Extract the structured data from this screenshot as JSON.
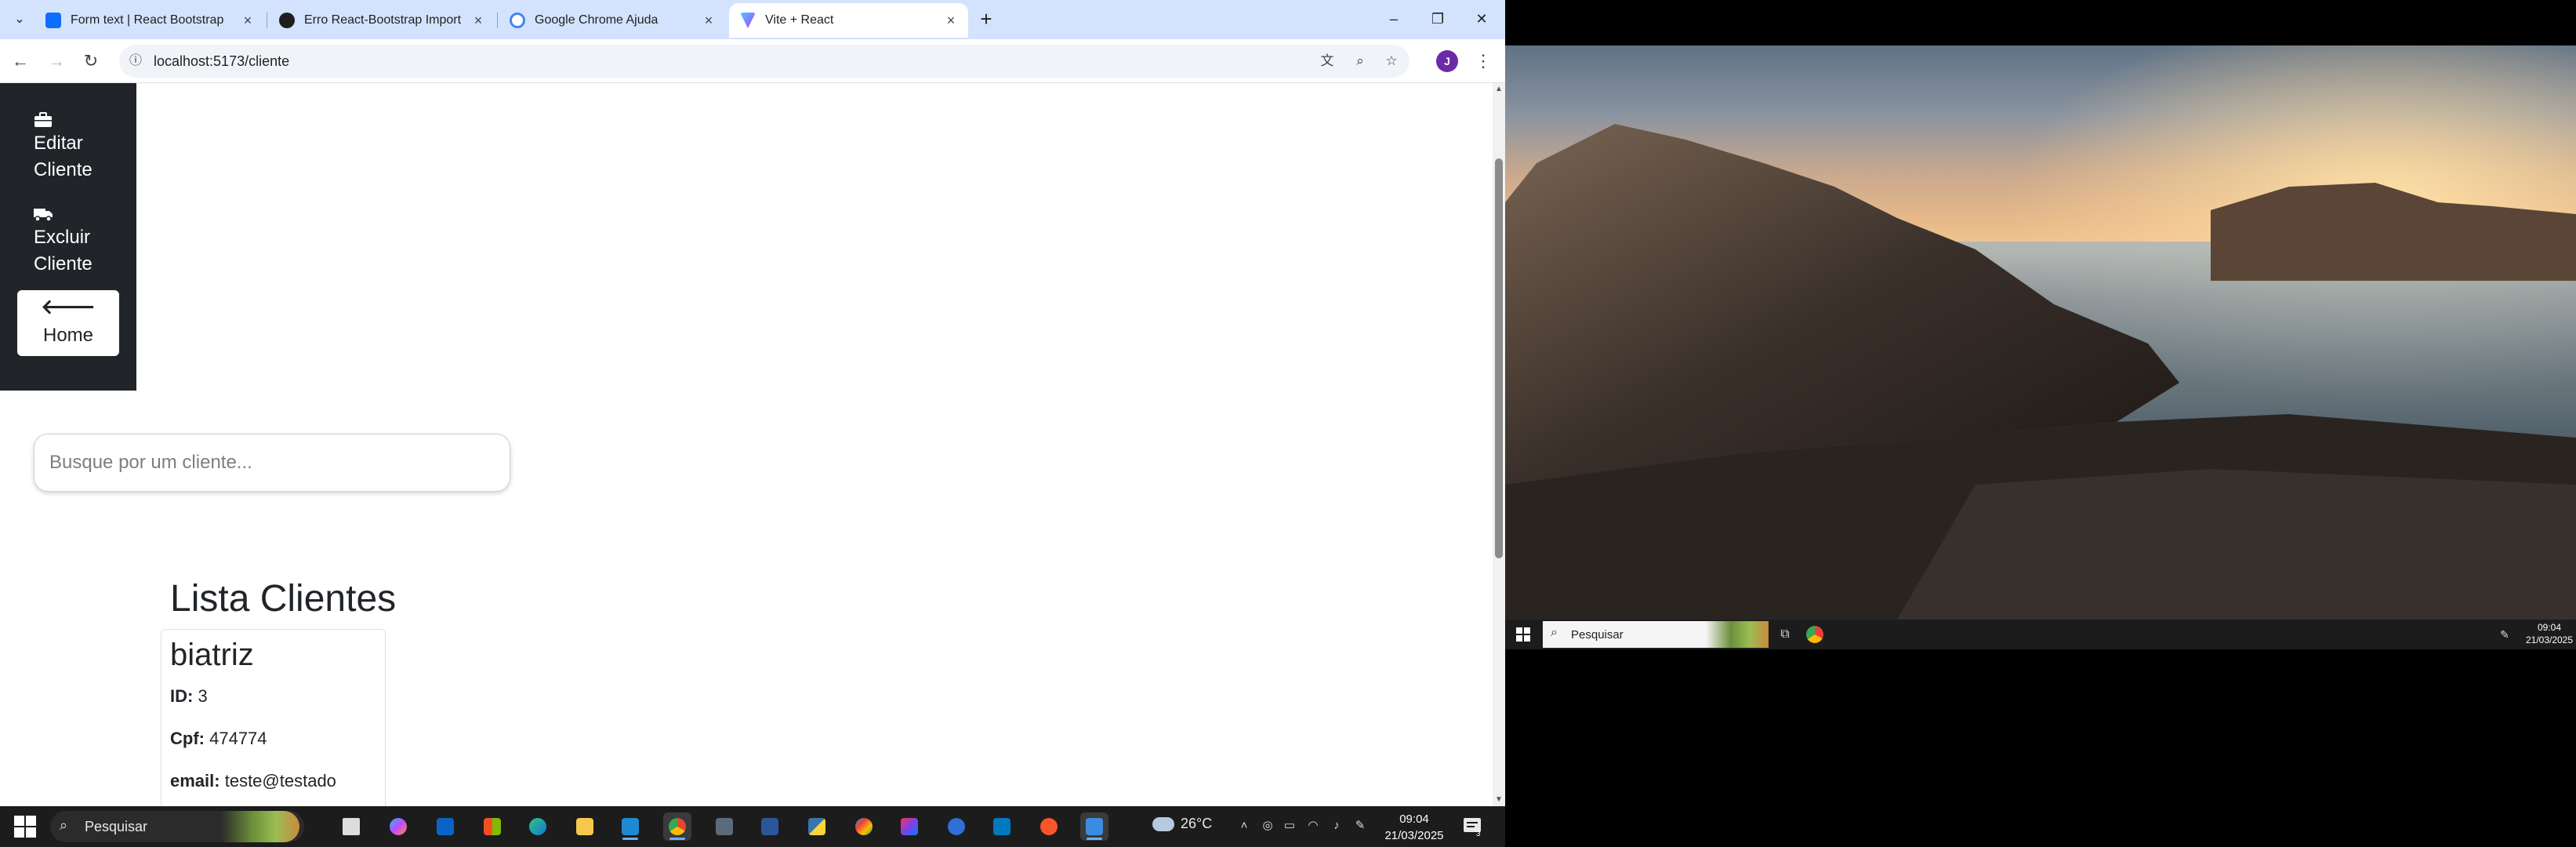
{
  "browser": {
    "tabs": [
      {
        "title": "Form text | React Bootstrap",
        "active": false,
        "favicon_color": "#0d6efd"
      },
      {
        "title": "Erro React-Bootstrap Import",
        "active": false,
        "favicon_color": "#1f1f1f"
      },
      {
        "title": "Google Chrome Ajuda",
        "active": false,
        "favicon_color": "#4285f4"
      },
      {
        "title": "Vite + React",
        "active": true,
        "favicon_color": "#9b59f6"
      }
    ],
    "new_tab": "+",
    "window": {
      "minimize": "–",
      "restore": "❐",
      "close": "✕"
    },
    "url": "localhost:5173/cliente",
    "profile_initial": "J",
    "icons": {
      "back": "arrow-left-icon",
      "forward": "arrow-right-icon",
      "reload": "reload-icon",
      "info": "site-info-icon",
      "translate": "translate-icon",
      "zoom": "zoom-icon",
      "bookmark": "star-icon",
      "menu": "kebab-menu-icon"
    }
  },
  "sidebar": {
    "items": [
      {
        "label_line1": "Editar",
        "label_line2": "Cliente",
        "icon": "briefcase-icon"
      },
      {
        "label_line1": "Excluir",
        "label_line2": "Cliente",
        "icon": "truck-icon"
      }
    ],
    "home": {
      "label": "Home",
      "icon": "arrow-left-icon"
    }
  },
  "search": {
    "placeholder": "Busque por um cliente...",
    "value": ""
  },
  "list": {
    "title": "Lista Clientes",
    "cards": [
      {
        "name": "biatriz",
        "id_label": "ID:",
        "id_value": "3",
        "cpf_label": "Cpf:",
        "cpf_value": "474774",
        "email_label": "email:",
        "email_value": "teste@testado"
      }
    ]
  },
  "taskbar": {
    "search_placeholder": "Pesquisar",
    "weather": "26°C",
    "time": "09:04",
    "date": "21/03/2025",
    "notification_count": "3",
    "apps": [
      "task-view",
      "copilot",
      "outlook",
      "store",
      "edge",
      "file-explorer",
      "vscode",
      "chrome",
      "calculator",
      "word",
      "python",
      "maps",
      "intellij",
      "app-blue",
      "trello",
      "brave",
      "app-active"
    ]
  },
  "monitor2": {
    "taskbar_search": "Pesquisar",
    "time": "09:04",
    "date": "21/03/2025"
  },
  "colors": {
    "sidebar_bg": "#212529",
    "tabstrip_bg": "#d3e3fd",
    "taskbar_bg": "#1c1c1c"
  }
}
